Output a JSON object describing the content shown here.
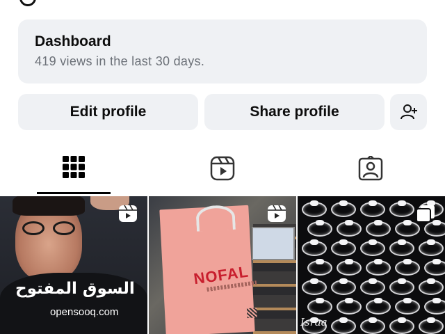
{
  "dashboard": {
    "title": "Dashboard",
    "subtitle": "419 views in the last 30 days."
  },
  "actions": {
    "edit_label": "Edit profile",
    "share_label": "Share profile",
    "add_icon": "add-person-icon"
  },
  "tabs": [
    {
      "icon": "grid-icon",
      "selected": true
    },
    {
      "icon": "reels-icon",
      "selected": false
    },
    {
      "icon": "tagged-icon",
      "selected": false
    }
  ],
  "posts": [
    {
      "type": "reel",
      "overlay_text": "السوق المفتوح",
      "watermark": "opensooq.com"
    },
    {
      "type": "reel",
      "brand_text": "NOFAL"
    },
    {
      "type": "carousel",
      "signature": "Israa"
    }
  ],
  "colors": {
    "card_bg": "#eff1f4",
    "subtitle": "#6b7077",
    "brand_red": "#c81e2d"
  }
}
